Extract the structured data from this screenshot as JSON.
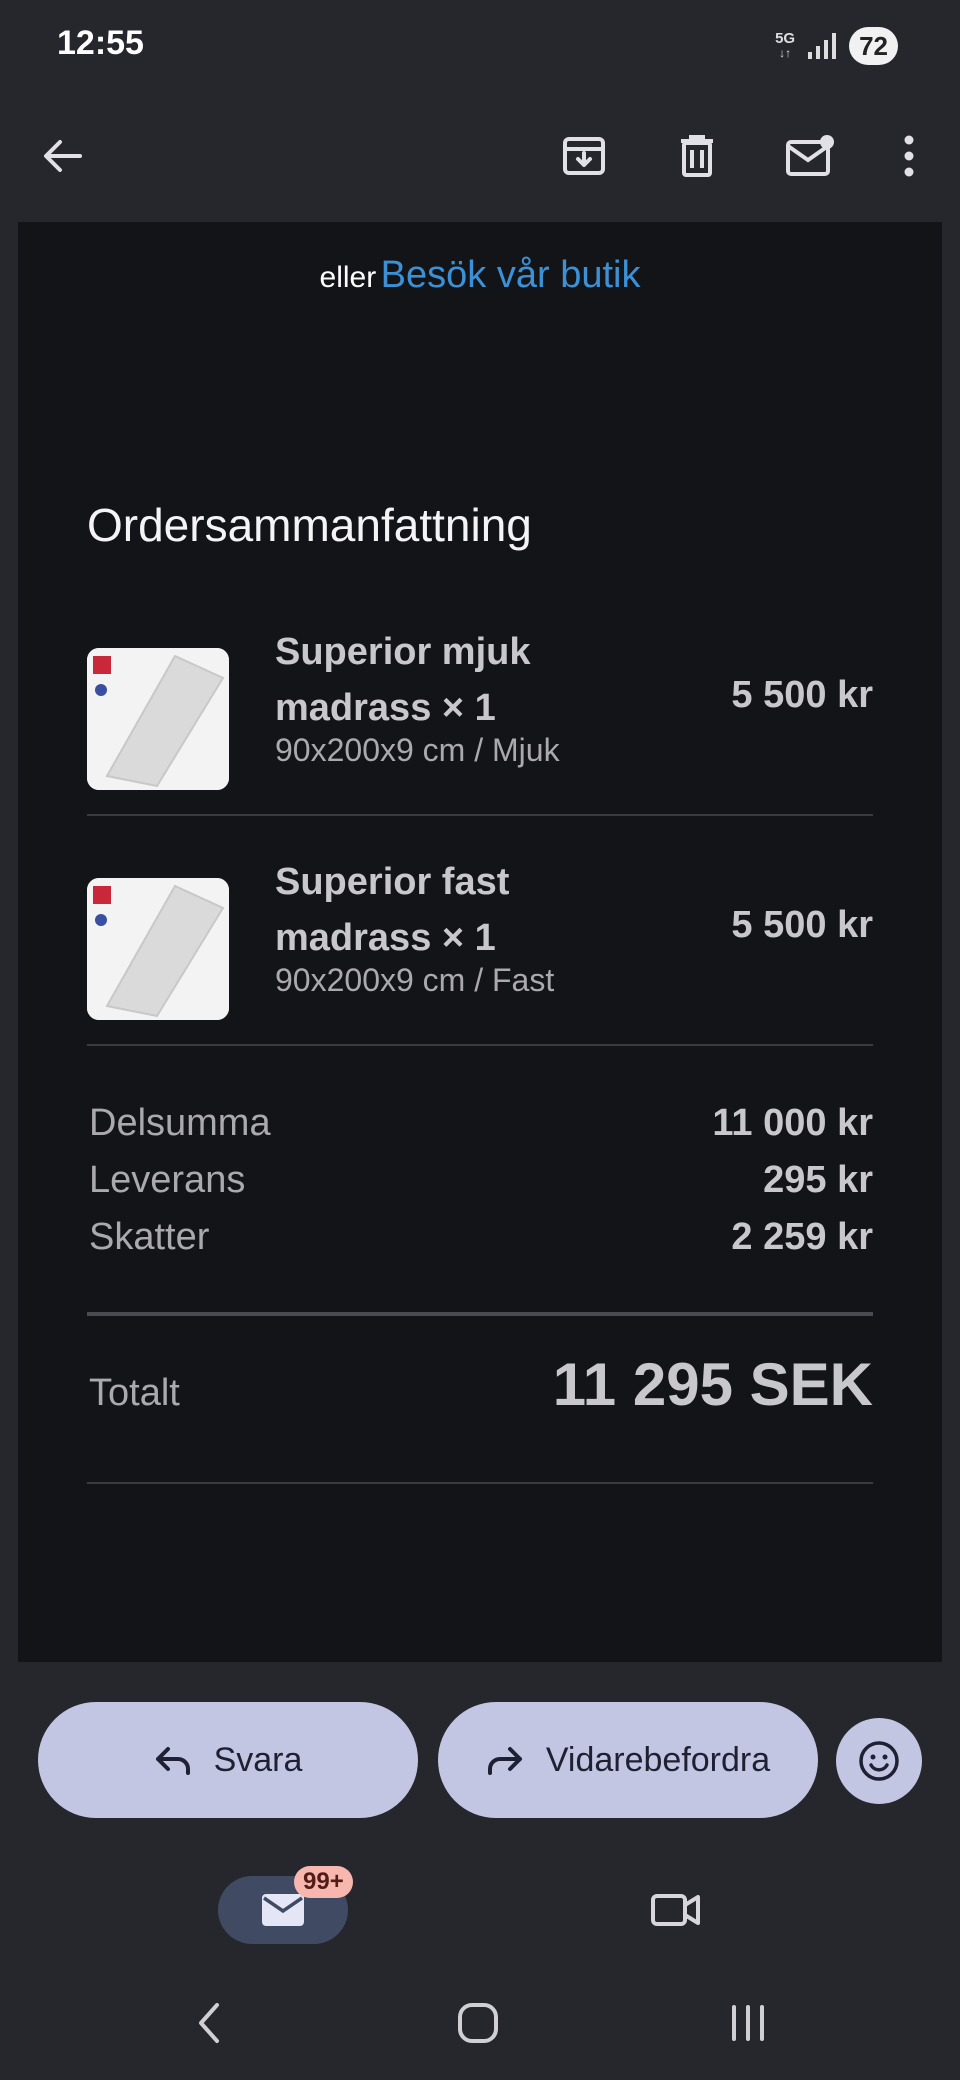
{
  "status_bar": {
    "time": "12:55",
    "network": "5G",
    "battery": "72"
  },
  "app_bar": {
    "icons": [
      "back-arrow-icon",
      "archive-icon",
      "delete-icon",
      "mark-unread-icon",
      "more-vert-icon"
    ]
  },
  "email": {
    "store_or": "eller",
    "store_link": "Besök vår butik",
    "summary_title": "Ordersammanfattning",
    "items": [
      {
        "name": "Superior mjuk madrass × 1",
        "variant": "90x200x9 cm / Mjuk",
        "price": "5 500 kr"
      },
      {
        "name": "Superior fast madrass × 1",
        "variant": "90x200x9 cm / Fast",
        "price": "5 500 kr"
      }
    ],
    "costs": [
      {
        "label": "Delsumma",
        "value": "11 000 kr"
      },
      {
        "label": "Leverans",
        "value": "295 kr"
      },
      {
        "label": "Skatter",
        "value": "2 259 kr"
      }
    ],
    "total": {
      "label": "Totalt",
      "value": "11 295 SEK"
    }
  },
  "actions": {
    "reply": "Svara",
    "forward": "Vidarebefordra"
  },
  "bottom_nav": {
    "mail_badge": "99+"
  },
  "colors": {
    "link": "#3c91d6",
    "action_button": "#c3c6e2",
    "badge": "#f7b7ae",
    "content_bg": "#131418",
    "chrome_bg": "#26272d"
  }
}
